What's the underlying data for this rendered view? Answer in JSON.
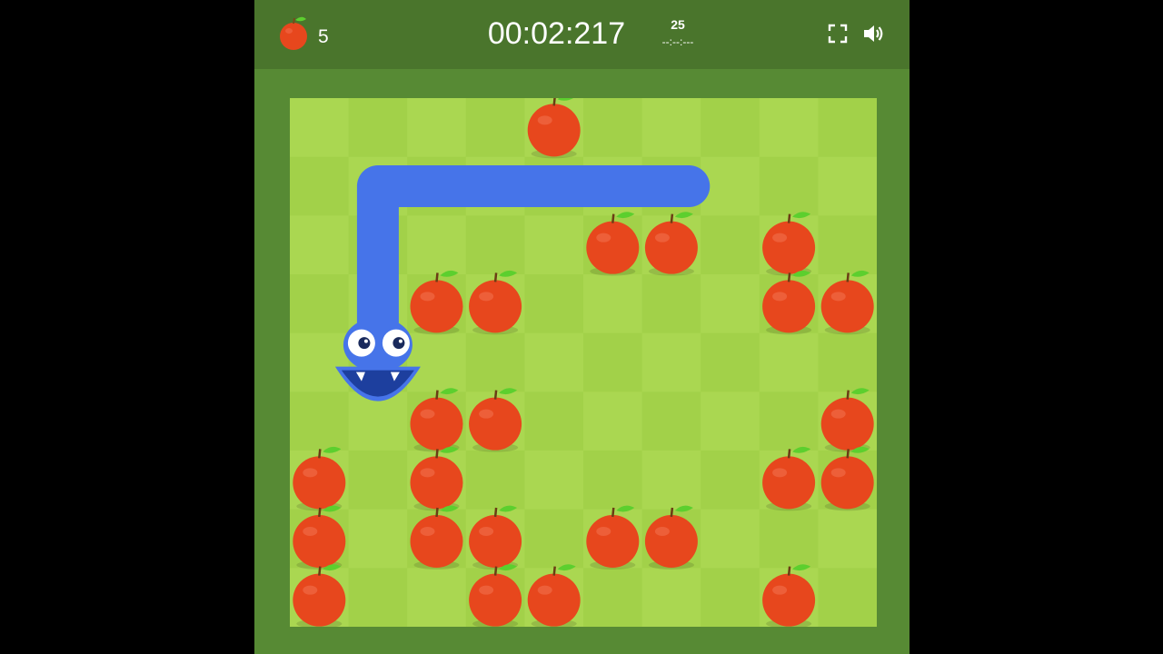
{
  "header": {
    "score": "5",
    "timer": "00:02:217",
    "best_score": "25",
    "best_time": "--:--:---",
    "icons": [
      "apple-icon",
      "fullscreen-icon",
      "sound-icon"
    ]
  },
  "board": {
    "columns": 10,
    "rows": 9,
    "colors": {
      "light_square": "#aad751",
      "dark_square": "#a2d149",
      "border": "#578a34",
      "header": "#4a752c",
      "snake": "#4674e9",
      "apple": "#e7471d",
      "leaf": "#5ccf2e"
    },
    "apples": [
      [
        4,
        0
      ],
      [
        5,
        2
      ],
      [
        6,
        2
      ],
      [
        8,
        2
      ],
      [
        2,
        3
      ],
      [
        3,
        3
      ],
      [
        8,
        3
      ],
      [
        9,
        3
      ],
      [
        2,
        5
      ],
      [
        3,
        5
      ],
      [
        9,
        5
      ],
      [
        0,
        6
      ],
      [
        2,
        6
      ],
      [
        8,
        6
      ],
      [
        9,
        6
      ],
      [
        0,
        7
      ],
      [
        2,
        7
      ],
      [
        3,
        7
      ],
      [
        5,
        7
      ],
      [
        6,
        7
      ],
      [
        0,
        8
      ],
      [
        3,
        8
      ],
      [
        4,
        8
      ],
      [
        8,
        8
      ]
    ],
    "snake": {
      "body": [
        [
          6.8,
          1.5
        ],
        [
          1.5,
          1.5
        ],
        [
          1.5,
          3.9
        ]
      ],
      "head": [
        1.5,
        4.2
      ],
      "direction": "down"
    }
  }
}
